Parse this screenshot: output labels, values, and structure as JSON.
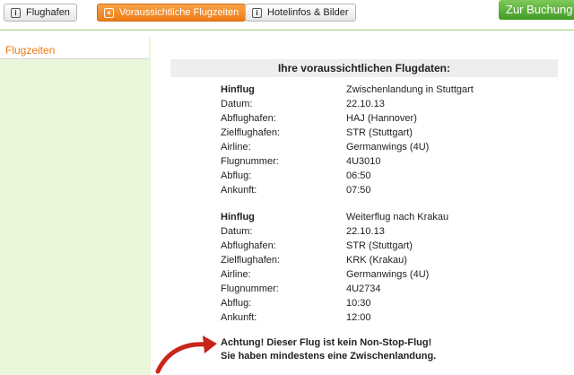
{
  "tabs": [
    {
      "label": "Flughafen",
      "icon": "info-icon"
    },
    {
      "label": "Voraussichtliche Flugzeiten",
      "icon": "close-icon"
    },
    {
      "label": "Hotelinfos & Bilder",
      "icon": "info-icon"
    }
  ],
  "book_button": "Zur Buchung ❯",
  "sidebar": {
    "item": "Flugzeiten"
  },
  "heading": "Ihre voraussichtlichen Flugdaten:",
  "flights": [
    {
      "title_label": "Hinflug",
      "title_value": "Zwischenlandung in Stuttgart",
      "rows": [
        {
          "k": "Datum:",
          "v": "22.10.13"
        },
        {
          "k": "Abflughafen:",
          "v": "HAJ (Hannover)"
        },
        {
          "k": "Zielflughafen:",
          "v": "STR (Stuttgart)"
        },
        {
          "k": "Airline:",
          "v": "Germanwings (4U)"
        },
        {
          "k": "Flugnummer:",
          "v": "4U3010"
        },
        {
          "k": "Abflug:",
          "v": "06:50"
        },
        {
          "k": "Ankunft:",
          "v": "07:50"
        }
      ]
    },
    {
      "title_label": "Hinflug",
      "title_value": "Weiterflug nach Krakau",
      "rows": [
        {
          "k": "Datum:",
          "v": "22.10.13"
        },
        {
          "k": "Abflughafen:",
          "v": "STR (Stuttgart)"
        },
        {
          "k": "Zielflughafen:",
          "v": "KRK (Krakau)"
        },
        {
          "k": "Airline:",
          "v": "Germanwings (4U)"
        },
        {
          "k": "Flugnummer:",
          "v": "4U2734"
        },
        {
          "k": "Abflug:",
          "v": "10:30"
        },
        {
          "k": "Ankunft:",
          "v": "12:00"
        }
      ]
    }
  ],
  "warning": {
    "line1": "Achtung! Dieser Flug ist kein Non-Stop-Flug!",
    "line2": "Sie haben mindestens eine Zwischenlandung."
  },
  "colors": {
    "accent_orange": "#ee7b14",
    "green": "#3f9a24",
    "sidebar_bg": "#e9f6d9",
    "arrow_red": "#c8251b"
  }
}
